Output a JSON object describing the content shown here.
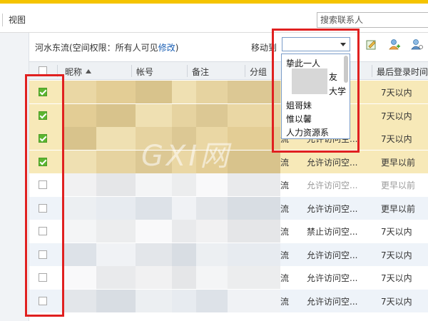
{
  "menubar": {
    "view_label": "视图"
  },
  "search": {
    "placeholder": "搜索联系人"
  },
  "space": {
    "prefix": "河水东流(空间权限：所有人可见",
    "edit_link": "修改",
    "suffix": ")"
  },
  "move_to": {
    "label": "移动到",
    "selected": ""
  },
  "columns": {
    "nickname": "昵称",
    "account": "帐号",
    "remark": "备注",
    "group": "分组",
    "last_login": "最后登录时间"
  },
  "dropdown": {
    "options": [
      "挚此一人",
      "友",
      "大学",
      "姐哥妹",
      "惟以馨",
      "人力资源系"
    ]
  },
  "rows": [
    {
      "checked": true,
      "selected": true,
      "group": "",
      "access": "",
      "last_login": "7天以内"
    },
    {
      "checked": true,
      "selected": true,
      "group": "",
      "access": "",
      "last_login": "7天以内"
    },
    {
      "checked": true,
      "selected": true,
      "group": "流",
      "access": "允许访问空...",
      "last_login": "7天以内"
    },
    {
      "checked": true,
      "selected": true,
      "group": "流",
      "access": "允许访问空...",
      "last_login": "更早以前"
    },
    {
      "checked": false,
      "selected": false,
      "group": "流",
      "access": "允许访问空...",
      "last_login": "更早以前"
    },
    {
      "checked": false,
      "selected": false,
      "group": "流",
      "access": "允许访问空...",
      "last_login": "更早以前"
    },
    {
      "checked": false,
      "selected": false,
      "group": "流",
      "access": "禁止访问空...",
      "last_login": "7天以内"
    },
    {
      "checked": false,
      "selected": false,
      "group": "流",
      "access": "允许访问空...",
      "last_login": "7天以内"
    },
    {
      "checked": false,
      "selected": false,
      "group": "流",
      "access": "允许访问空...",
      "last_login": "7天以内"
    },
    {
      "checked": false,
      "selected": false,
      "group": "流",
      "access": "允许访问空...",
      "last_login": "7天以内"
    }
  ],
  "watermark": "GXI网",
  "colors": {
    "accent_bar": "#f5c400",
    "selected_row": "#f7e9b8",
    "highlight_box": "#e02020",
    "check_green": "#5cb531",
    "link": "#1a5fb4"
  }
}
